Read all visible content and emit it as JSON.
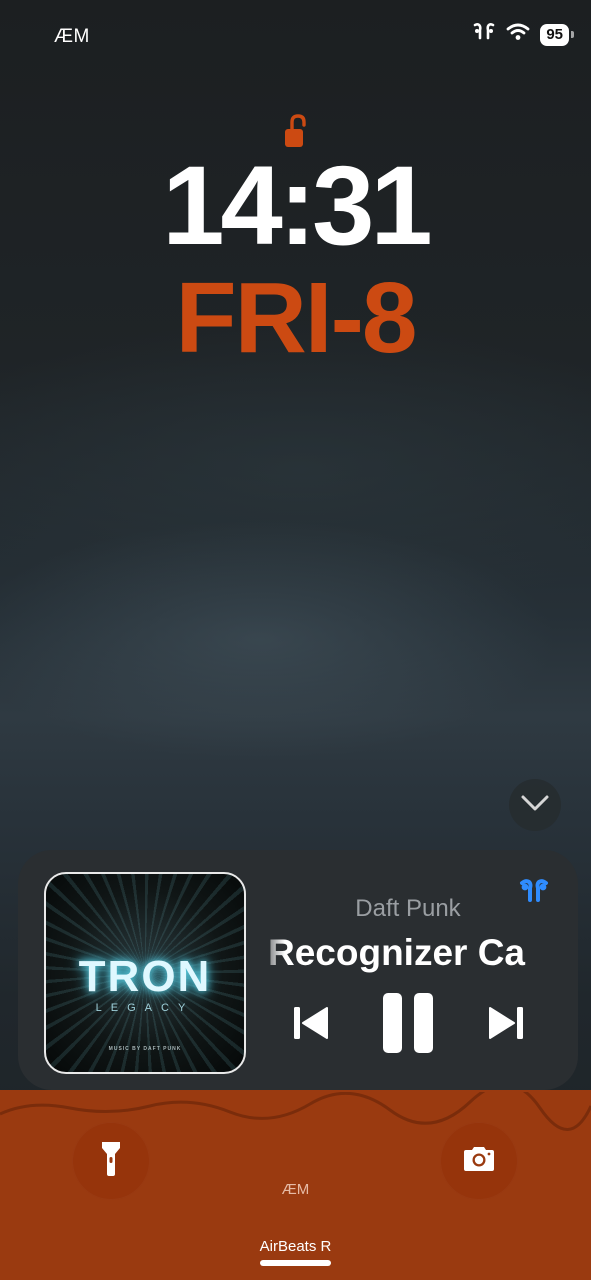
{
  "status_bar": {
    "carrier": "ÆM",
    "battery": "95",
    "icons": [
      "airpods-status-icon",
      "wifi-icon",
      "battery-icon"
    ]
  },
  "lock_screen": {
    "lock_icon": "unlocked-padlock-icon",
    "time": "14:31",
    "date": "FRI-8",
    "accent_color": "#cc4a12"
  },
  "now_playing": {
    "artist": "Daft Punk",
    "track": "Recognizer Ca",
    "album_art": {
      "title": "TRON",
      "subtitle": "LEGACY",
      "credit": "MUSIC BY DAFT PUNK"
    },
    "output_icon": "airpods-icon",
    "state": "playing",
    "controls": [
      "previous-track",
      "pause",
      "next-track"
    ]
  },
  "quick_actions": {
    "left": "flashlight-icon",
    "right": "camera-icon",
    "center_label": "ÆM"
  },
  "footer": {
    "device_name": "AirBeats R"
  }
}
